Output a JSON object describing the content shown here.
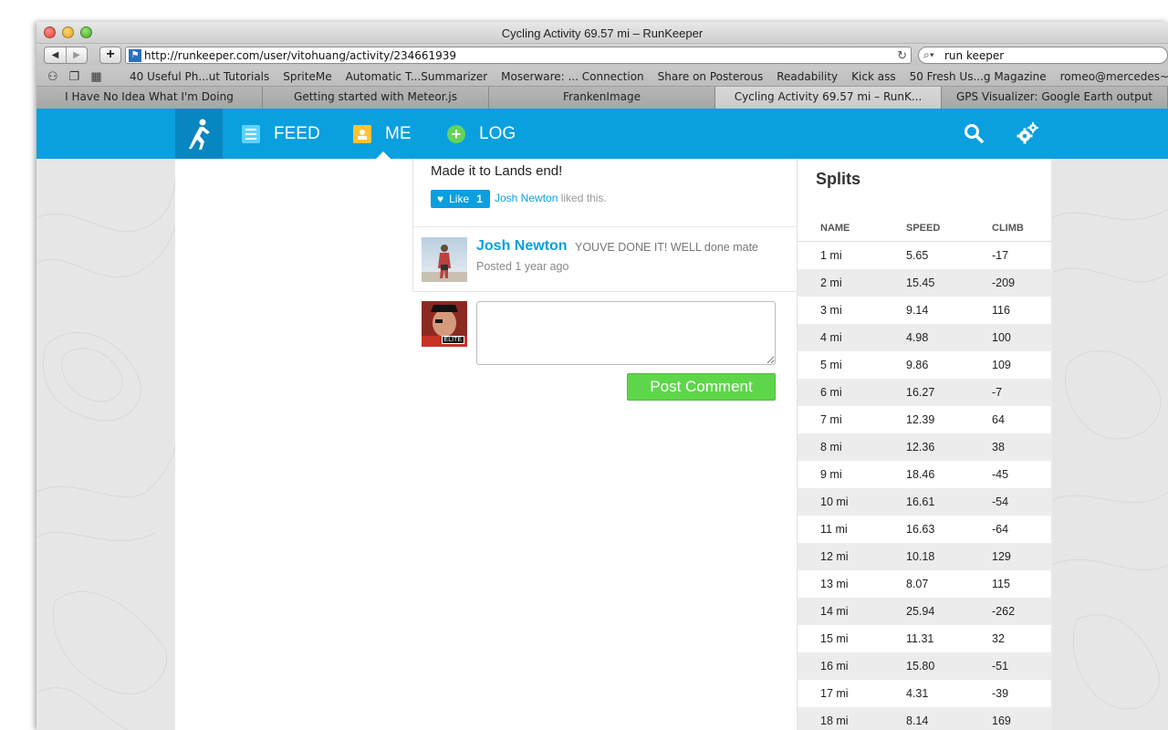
{
  "window": {
    "title": "Cycling Activity 69.57 mi – RunKeeper"
  },
  "toolbar": {
    "url": "http://runkeeper.com/user/vitohuang/activity/234661939",
    "search_value": "run keeper",
    "back_icon": "◀",
    "forward_icon": "▶",
    "add_icon": "+",
    "reload_icon": "↻",
    "search_icon": "🔍"
  },
  "bookmarks": [
    "40 Useful Ph...ut Tutorials",
    "SpriteMe",
    "Automatic T...Summarizer",
    "Moserware: ... Connection",
    "Share on Posterous",
    "Readability",
    "Kick ass",
    "50 Fresh Us...g Magazine",
    "romeo@mercedes~$"
  ],
  "tabs": [
    "I Have No Idea What I'm Doing",
    "Getting started with Meteor.js",
    "FrankenImage",
    "Cycling Activity 69.57 mi – RunK...",
    "GPS Visualizer: Google Earth output"
  ],
  "nav": {
    "feed": "FEED",
    "me": "ME",
    "log": "LOG"
  },
  "activity": {
    "caption": "Made it to Lands end!",
    "like_label": "Like",
    "like_count": "1",
    "liked_by": "Josh Newton",
    "liked_suffix": "liked this."
  },
  "comment": {
    "author": "Josh Newton",
    "text": "YOUVE DONE IT! WELL done mate",
    "posted": "Posted 1 year ago"
  },
  "composer": {
    "elite_badge": "ELITE",
    "post_label": "Post Comment"
  },
  "splits": {
    "title": "Splits",
    "headers": {
      "name": "NAME",
      "speed": "SPEED",
      "climb": "CLIMB"
    },
    "rows": [
      {
        "name": "1 mi",
        "speed": "5.65",
        "climb": "-17"
      },
      {
        "name": "2 mi",
        "speed": "15.45",
        "climb": "-209"
      },
      {
        "name": "3 mi",
        "speed": "9.14",
        "climb": "116"
      },
      {
        "name": "4 mi",
        "speed": "4.98",
        "climb": "100"
      },
      {
        "name": "5 mi",
        "speed": "9.86",
        "climb": "109"
      },
      {
        "name": "6 mi",
        "speed": "16.27",
        "climb": "-7"
      },
      {
        "name": "7 mi",
        "speed": "12.39",
        "climb": "64"
      },
      {
        "name": "8 mi",
        "speed": "12.36",
        "climb": "38"
      },
      {
        "name": "9 mi",
        "speed": "18.46",
        "climb": "-45"
      },
      {
        "name": "10 mi",
        "speed": "16.61",
        "climb": "-54"
      },
      {
        "name": "11 mi",
        "speed": "16.63",
        "climb": "-64"
      },
      {
        "name": "12 mi",
        "speed": "10.18",
        "climb": "129"
      },
      {
        "name": "13 mi",
        "speed": "8.07",
        "climb": "115"
      },
      {
        "name": "14 mi",
        "speed": "25.94",
        "climb": "-262"
      },
      {
        "name": "15 mi",
        "speed": "11.31",
        "climb": "32"
      },
      {
        "name": "16 mi",
        "speed": "15.80",
        "climb": "-51"
      },
      {
        "name": "17 mi",
        "speed": "4.31",
        "climb": "-39"
      },
      {
        "name": "18 mi",
        "speed": "8.14",
        "climb": "169"
      }
    ]
  },
  "colors": {
    "brand_blue": "#0a9fdf",
    "post_green": "#5ed64a"
  }
}
